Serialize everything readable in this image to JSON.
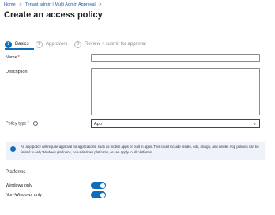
{
  "breadcrumb": {
    "items": [
      "Home",
      "Tenant admin | Multi Admin Approval"
    ],
    "sep": ">"
  },
  "page": {
    "title": "Create an access policy",
    "more_label": "···"
  },
  "steps": [
    {
      "num": "1",
      "label": "Basics"
    },
    {
      "num": "2",
      "label": "Approvers"
    },
    {
      "num": "3",
      "label": "Review + submit for approval"
    }
  ],
  "form": {
    "name_label": "Name",
    "required_mark": "*",
    "name_value": "",
    "description_label": "Description",
    "description_value": "",
    "policy_type_label": "Policy type",
    "policy_type_value": "App",
    "info_glyph": "i"
  },
  "info_bar": {
    "text": "An app policy will require approval for applications, such as mobile apps or built in apps. This could include create, edit, assign, and delete. App policies can be limited to only Windows platforms, non-Windows platforms, or can apply to all platforms."
  },
  "platforms": {
    "heading": "Platforms",
    "windows_label": "Windows only",
    "non_windows_label": "Non-Windows only",
    "windows_on": true,
    "non_windows_on": true
  },
  "colors": {
    "accent": "#0f6cbd",
    "link": "#1a5fb4",
    "select_border": "#6b2a78",
    "info_bg": "#eef3fb"
  },
  "icons": {
    "more": "more-options-icon",
    "info": "info-icon",
    "chevron": "chevron-down-icon"
  }
}
